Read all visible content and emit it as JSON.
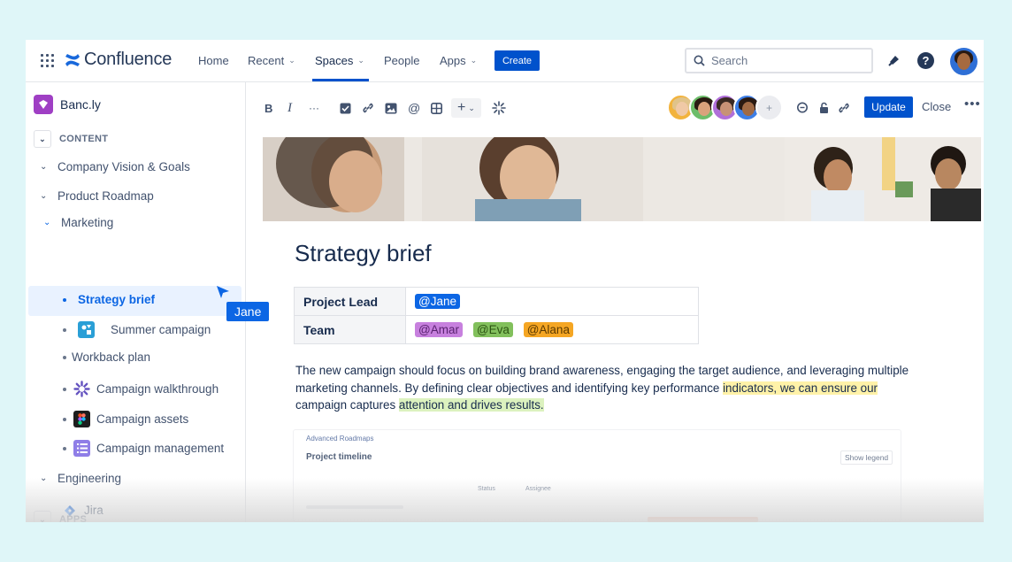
{
  "topnav": {
    "app_name": "Confluence",
    "items": [
      {
        "label": "Home"
      },
      {
        "label": "Recent"
      },
      {
        "label": "Spaces"
      },
      {
        "label": "People"
      },
      {
        "label": "Apps"
      }
    ],
    "create_label": "Create",
    "search_placeholder": "Search"
  },
  "sidebar": {
    "space_name": "Banc.ly",
    "content_header": "CONTENT",
    "items": [
      {
        "label": "Company Vision & Goals"
      },
      {
        "label": "Product Roadmap"
      },
      {
        "label": "Marketing"
      },
      {
        "label": "Strategy brief"
      },
      {
        "label": "Summer campaign"
      },
      {
        "label": "Workback plan"
      },
      {
        "label": "Campaign walkthrough"
      },
      {
        "label": "Campaign assets"
      },
      {
        "label": "Campaign management"
      },
      {
        "label": "Engineering"
      }
    ],
    "apps_header": "APPS",
    "apps": [
      {
        "label": "Jira"
      }
    ],
    "cursor_user": "Jane"
  },
  "toolbar": {
    "update_label": "Update",
    "close_label": "Close",
    "more_label": "•••"
  },
  "page": {
    "title": "Strategy brief",
    "table": {
      "lead_label": "Project Lead",
      "lead_mention": "@Jane",
      "team_label": "Team",
      "team_mentions": [
        "@Amar",
        "@Eva",
        "@Alana"
      ]
    },
    "paragraph": {
      "part1": "The new campaign should focus on building brand awareness, engaging the target audience, and leveraging multiple marketing channels. By defining clear objectives and identifying key performance ",
      "highlight1": "indicators, we can ensure our",
      "part2": " campaign captures ",
      "highlight2": "attention and drives results."
    },
    "roadmap": {
      "label": "Advanced Roadmaps",
      "title": "Project timeline",
      "legend_button": "Show legend",
      "col_status": "Status",
      "col_assignee": "Assignee"
    }
  },
  "colors": {
    "brand_blue": "#0052cc",
    "selection_blue": "#0c66e4",
    "highlight_yellow": "#fff2a8",
    "highlight_green": "#dcf2bf"
  }
}
